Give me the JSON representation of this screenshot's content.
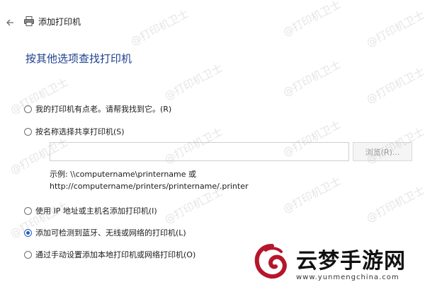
{
  "window": {
    "title": "添加打印机",
    "back_icon": "back-arrow-icon",
    "app_icon": "printer-icon"
  },
  "heading": "按其他选项查找打印机",
  "options": [
    {
      "label": "我的打印机有点老。请帮我找到它。(R)",
      "checked": false
    },
    {
      "label": "按名称选择共享打印机(S)",
      "checked": false
    },
    {
      "label": "使用 IP 地址或主机名添加打印机(I)",
      "checked": false
    },
    {
      "label": "添加可检测到蓝牙、无线或网络的打印机(L)",
      "checked": true
    },
    {
      "label": "通过手动设置添加本地打印机或网络打印机(O)",
      "checked": false
    }
  ],
  "share_input": {
    "value": "",
    "placeholder": ""
  },
  "browse_button": "浏览(R)...",
  "example_line1": "示例: \\\\computername\\printername 或",
  "example_line2": "http://computername/printers/printername/.printer",
  "watermark_text": "@打印机卫士",
  "logo": {
    "name": "云梦手游网",
    "url": "www.yunmengchina.com"
  },
  "colors": {
    "heading": "#1f3f8f",
    "accent": "#1f5fc0"
  }
}
